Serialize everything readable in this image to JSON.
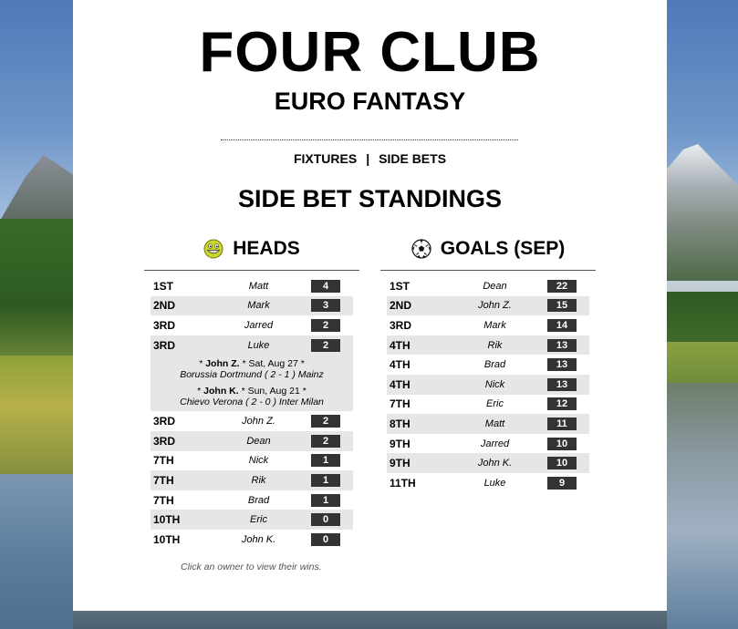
{
  "title": "FOUR CLUB",
  "subtitle": "EURO FANTASY",
  "nav": {
    "fixtures": "FIXTURES",
    "separator": "|",
    "side_bets": "SIDE BETS"
  },
  "page_title": "SIDE BET STANDINGS",
  "heads": {
    "title": "HEADS",
    "icon": "grinning-face-icon",
    "rows": [
      {
        "rank": "1ST",
        "owner": "Matt",
        "count": "4"
      },
      {
        "rank": "2ND",
        "owner": "Mark",
        "count": "3"
      },
      {
        "rank": "3RD",
        "owner": "Jarred",
        "count": "2"
      },
      {
        "rank": "3RD",
        "owner": "Luke",
        "count": "2"
      }
    ],
    "tiebreak": [
      {
        "owner": "John Z.",
        "date": "Sat, Aug 27",
        "match": "Borussia Dortmund ( 2 - 1 ) Mainz"
      },
      {
        "owner": "John K.",
        "date": "Sun, Aug 21",
        "match": "Chievo Verona ( 2 - 0 ) Inter Milan"
      }
    ],
    "rows_after": [
      {
        "rank": "3RD",
        "owner": "John Z.",
        "count": "2"
      },
      {
        "rank": "3RD",
        "owner": "Dean",
        "count": "2"
      },
      {
        "rank": "7TH",
        "owner": "Nick",
        "count": "1"
      },
      {
        "rank": "7TH",
        "owner": "Rik",
        "count": "1"
      },
      {
        "rank": "7TH",
        "owner": "Brad",
        "count": "1"
      },
      {
        "rank": "10TH",
        "owner": "Eric",
        "count": "0"
      },
      {
        "rank": "10TH",
        "owner": "John K.",
        "count": "0"
      }
    ]
  },
  "goals": {
    "title": "GOALS (SEP)",
    "icon": "soccer-ball-icon",
    "rows": [
      {
        "rank": "1ST",
        "owner": "Dean",
        "count": "22"
      },
      {
        "rank": "2ND",
        "owner": "John Z.",
        "count": "15"
      },
      {
        "rank": "3RD",
        "owner": "Mark",
        "count": "14"
      },
      {
        "rank": "4TH",
        "owner": "Rik",
        "count": "13"
      },
      {
        "rank": "4TH",
        "owner": "Brad",
        "count": "13"
      },
      {
        "rank": "4TH",
        "owner": "Nick",
        "count": "13"
      },
      {
        "rank": "7TH",
        "owner": "Eric",
        "count": "12"
      },
      {
        "rank": "8TH",
        "owner": "Matt",
        "count": "11"
      },
      {
        "rank": "9TH",
        "owner": "Jarred",
        "count": "10"
      },
      {
        "rank": "9TH",
        "owner": "John K.",
        "count": "10"
      },
      {
        "rank": "11TH",
        "owner": "Luke",
        "count": "9"
      }
    ]
  },
  "hint": "Click an owner to view their wins.",
  "colors": {
    "badge": "#333333",
    "row_alt": "#e6e6e6"
  }
}
